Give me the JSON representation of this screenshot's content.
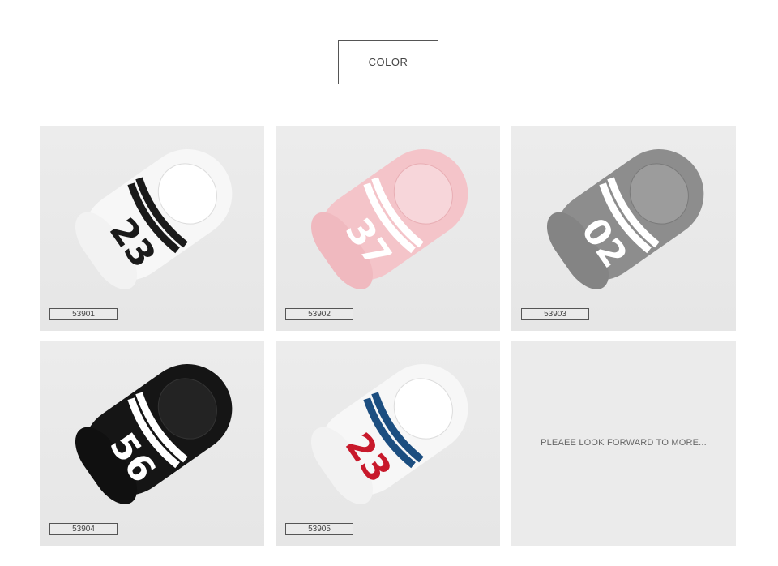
{
  "header": {
    "label": "COLOR"
  },
  "products": [
    {
      "code": "53901",
      "number": "23",
      "colors": {
        "body": "#f7f7f7",
        "stripe": "#1a1a1a",
        "num": "#1a1a1a",
        "heel": "#f2f2f2"
      }
    },
    {
      "code": "53902",
      "number": "37",
      "colors": {
        "body": "#f4c4c9",
        "stripe": "#ffffff",
        "num": "#ffffff",
        "heel": "#f0b9bf"
      }
    },
    {
      "code": "53903",
      "number": "02",
      "colors": {
        "body": "#8d8d8d",
        "stripe": "#ffffff",
        "num": "#ffffff",
        "heel": "#848484"
      }
    },
    {
      "code": "53904",
      "number": "56",
      "colors": {
        "body": "#151515",
        "stripe": "#ffffff",
        "num": "#ffffff",
        "heel": "#101010"
      }
    },
    {
      "code": "53905",
      "number": "23",
      "colors": {
        "body": "#f7f7f7",
        "stripe": "#1c4e80",
        "num": "#c8192b",
        "heel": "#f2f2f2"
      }
    }
  ],
  "more_tile": {
    "text": "PLEAEE LOOK FORWARD TO MORE..."
  }
}
